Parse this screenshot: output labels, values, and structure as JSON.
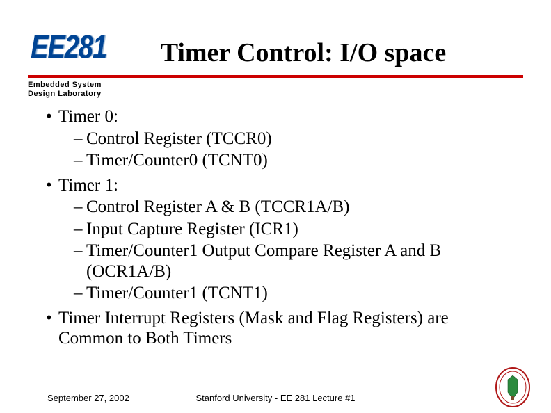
{
  "logo_text": "EE281",
  "title": "Timer Control: I/O space",
  "subhead_line1": "Embedded System",
  "subhead_line2": "Design Laboratory",
  "bullets": {
    "b1": "Timer 0:",
    "b1_1": "Control Register (TCCR0)",
    "b1_2": "Timer/Counter0 (TCNT0)",
    "b2": "Timer 1:",
    "b2_1": "Control Register A & B (TCCR1A/B)",
    "b2_2": "Input Capture Register (ICR1)",
    "b2_3": "Timer/Counter1 Output Compare Register A and B (OCR1A/B)",
    "b2_4": "Timer/Counter1 (TCNT1)",
    "b3": "Timer Interrupt Registers (Mask and Flag Registers) are Common to Both Timers"
  },
  "footer": {
    "date": "September 27, 2002",
    "center": "Stanford University - EE 281 Lecture #1"
  },
  "colors": {
    "rule": "#cc0000",
    "logo": "#004494"
  }
}
